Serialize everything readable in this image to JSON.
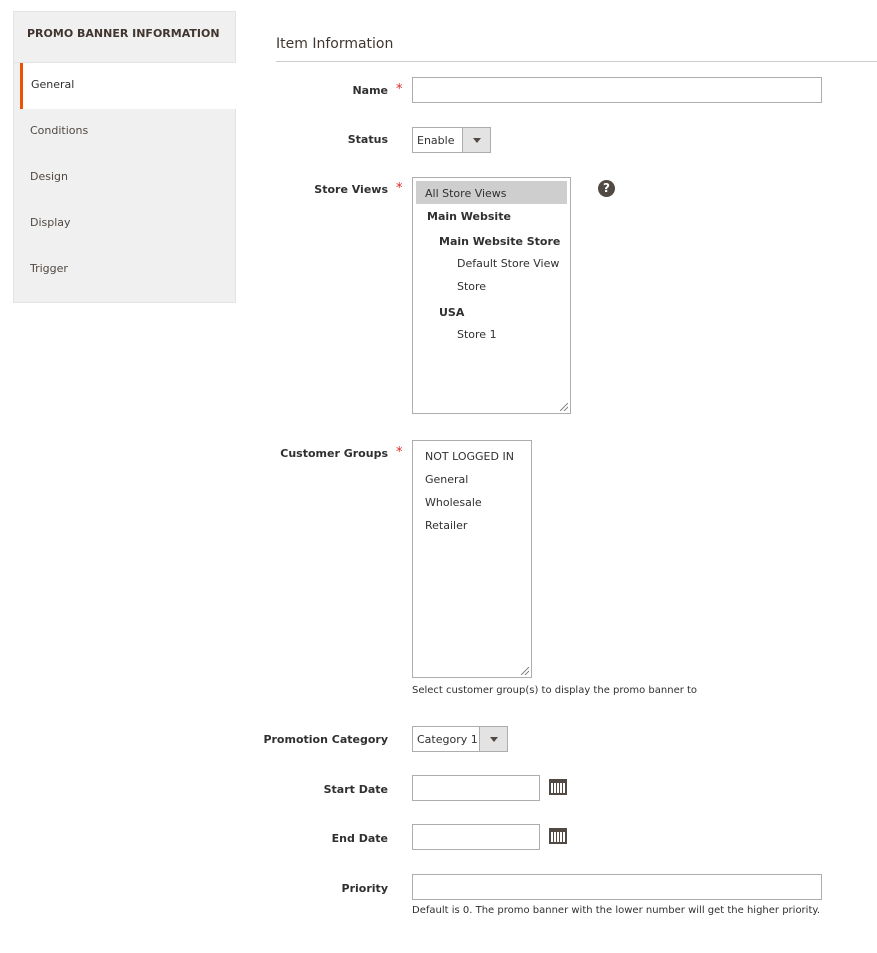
{
  "sidebar": {
    "title": "PROMO BANNER INFORMATION",
    "items": [
      {
        "label": "General",
        "active": true
      },
      {
        "label": "Conditions"
      },
      {
        "label": "Design"
      },
      {
        "label": "Display"
      },
      {
        "label": "Trigger"
      }
    ]
  },
  "section": {
    "title": "Item Information"
  },
  "form": {
    "required_mark": "*",
    "name": {
      "label": "Name",
      "value": ""
    },
    "status": {
      "label": "Status",
      "value": "Enable"
    },
    "store_views": {
      "label": "Store Views",
      "help_icon": "?",
      "options": [
        "All Store Views",
        "Main Website",
        "Main Website Store",
        "Default Store View",
        "Store",
        "USA",
        "Store 1"
      ],
      "selected": "All Store Views"
    },
    "customer_groups": {
      "label": "Customer Groups",
      "options": [
        "NOT LOGGED IN",
        "General",
        "Wholesale",
        "Retailer"
      ],
      "note": "Select customer group(s) to display the promo banner to"
    },
    "promotion_category": {
      "label": "Promotion Category",
      "value": "Category 1"
    },
    "start_date": {
      "label": "Start Date",
      "value": ""
    },
    "end_date": {
      "label": "End Date",
      "value": ""
    },
    "priority": {
      "label": "Priority",
      "value": "",
      "note": "Default is 0. The promo banner with the lower number will get the higher priority."
    }
  },
  "colors": {
    "accent": "#eb5202",
    "required": "#e22626"
  }
}
